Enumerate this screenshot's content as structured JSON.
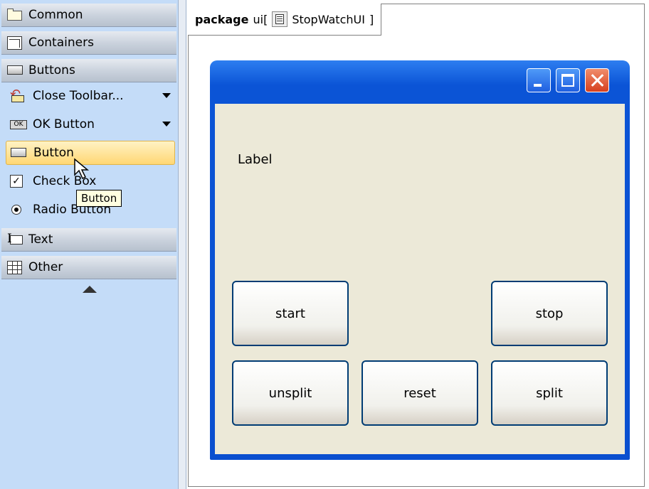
{
  "palette": {
    "groups": {
      "common": "Common",
      "containers": "Containers",
      "buttons": "Buttons",
      "text": "Text",
      "other": "Other"
    },
    "items": {
      "close_toolbar": "Close Toolbar...",
      "ok_button": "OK Button",
      "button": "Button",
      "check_box": "Check Box",
      "radio_button": "Radio Button"
    },
    "tooltip": "Button"
  },
  "diagram": {
    "frame_keyword": "package",
    "frame_name": "ui",
    "frame_bracket_open": "[",
    "frame_diagram": "StopWatchUI",
    "frame_bracket_close": "]",
    "window": {
      "label": "Label",
      "buttons": {
        "start": "start",
        "stop": "stop",
        "unsplit": "unsplit",
        "reset": "reset",
        "split": "split"
      }
    }
  },
  "colors": {
    "palette_bg": "#c4dcf8",
    "selected_item": "#ffd774",
    "window_frame": "#0a4fcf",
    "window_client": "#ece9d8",
    "button_border": "#003c74"
  },
  "icons": [
    "folder-icon",
    "container-icon",
    "button-icon",
    "close-toolbar-icon",
    "ok-button-icon",
    "check-box-icon",
    "radio-button-icon",
    "text-icon",
    "table-icon",
    "collapse-arrow-icon",
    "diagram-icon",
    "minimize-icon",
    "maximize-icon",
    "close-icon"
  ]
}
